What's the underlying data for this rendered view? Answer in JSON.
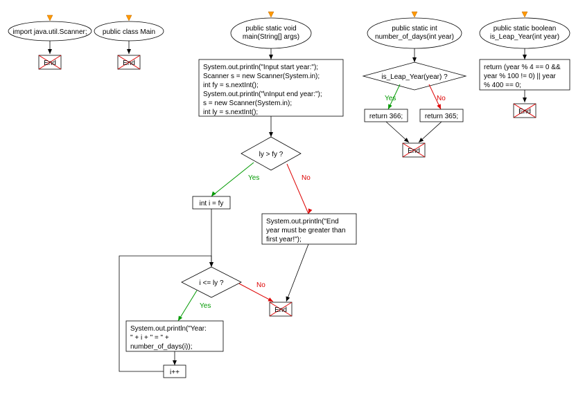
{
  "entries": {
    "e1": "import java.util.Scanner;",
    "e2": "public class Main",
    "e3_l1": "public static void",
    "e3_l2": "main(String[] args)",
    "e4_l1": "public static int",
    "e4_l2": "number_of_days(int year)",
    "e5_l1": "public static boolean",
    "e5_l2": "is_Leap_Year(int year)"
  },
  "boxes": {
    "b_main_l1": "System.out.println(\"Input start year:\");",
    "b_main_l2": "Scanner s = new Scanner(System.in);",
    "b_main_l3": "int fy = s.nextInt();",
    "b_main_l4": "System.out.println(\"\\nInput end year:\");",
    "b_main_l5": "s = new Scanner(System.in);",
    "b_main_l6": "int ly = s.nextInt();",
    "b_init_i": "int i = fy",
    "b_err_l1": "System.out.println(\"End",
    "b_err_l2": "year must be greater than",
    "b_err_l3": "first year!\");",
    "b_print_l1": "System.out.println(\"Year:",
    "b_print_l2": "\" + i + \" = \" +",
    "b_print_l3": "number_of_days(i));",
    "b_inc": "i++",
    "b_ret366": "return 366;",
    "b_ret365": "return 365;",
    "b_leap_l1": "return (year % 4 == 0 &&",
    "b_leap_l2": "year % 100 != 0) || year",
    "b_leap_l3": "% 400 == 0;"
  },
  "decisions": {
    "d_lygt": "ly > fy ?",
    "d_ile": "i <= ly ?",
    "d_isleap": "is_Leap_Year(year) ?"
  },
  "labels": {
    "yes": "Yes",
    "no": "No",
    "end": "End"
  }
}
